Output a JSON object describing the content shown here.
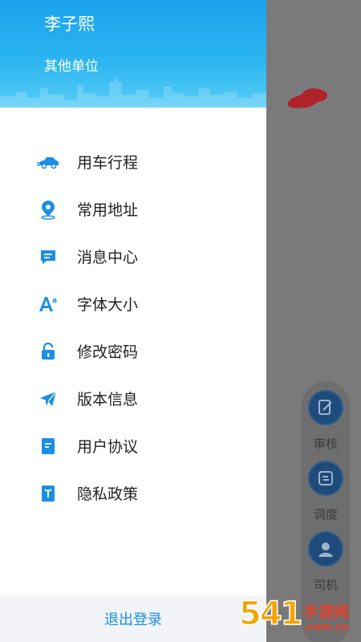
{
  "drawer": {
    "user_name": "李子熙",
    "user_org": "其他单位",
    "menu": [
      {
        "label": "用车行程",
        "icon": "car-icon"
      },
      {
        "label": "常用地址",
        "icon": "location-pin-icon"
      },
      {
        "label": "消息中心",
        "icon": "message-icon"
      },
      {
        "label": "字体大小",
        "icon": "font-size-icon"
      },
      {
        "label": "修改密码",
        "icon": "lock-icon"
      },
      {
        "label": "版本信息",
        "icon": "paper-plane-icon"
      },
      {
        "label": "用户协议",
        "icon": "document-icon"
      },
      {
        "label": "隐私政策",
        "icon": "privacy-icon"
      }
    ],
    "logout_label": "退出登录"
  },
  "side_panel": {
    "buttons": [
      {
        "label": "审核",
        "icon": "review-icon"
      },
      {
        "label": "调度",
        "icon": "dispatch-icon"
      },
      {
        "label": "司机",
        "icon": "driver-icon"
      }
    ]
  },
  "watermark": {
    "number": "541",
    "name": "手游网",
    "domain": ".com.cn"
  },
  "colors": {
    "header_top": "#1aa3ec",
    "header_bottom": "#58cdf6",
    "icon_blue": "#1a8fe3",
    "logout_text": "#1a8fe3",
    "overlay": "#7a7a7a"
  }
}
